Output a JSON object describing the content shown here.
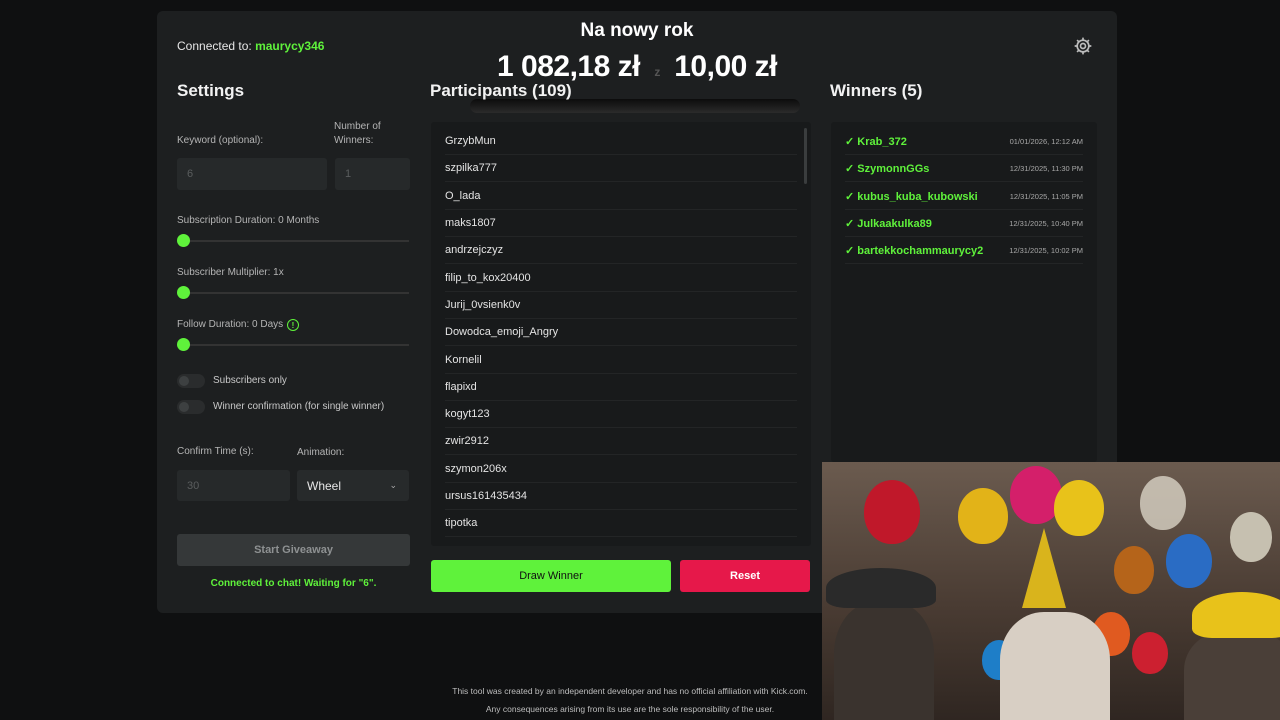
{
  "header": {
    "connected_label": "Connected to: ",
    "connected_user": "maurycy346"
  },
  "overlay": {
    "title": "Na nowy rok",
    "amount_left": "1 082,18 zł",
    "amount_mid": "z",
    "amount_right": "10,00 zł"
  },
  "settings": {
    "title": "Settings",
    "keyword_label": "Keyword (optional):",
    "keyword_value": "6",
    "winners_label": "Number of Winners:",
    "winners_value": "1",
    "sub_duration_label": "Subscription Duration: 0 Months",
    "sub_multiplier_label": "Subscriber Multiplier: 1x",
    "follow_duration_label": "Follow Duration: 0 Days",
    "subscribers_only_label": "Subscribers only",
    "winner_confirmation_label": "Winner confirmation (for single winner)",
    "confirm_time_label": "Confirm Time (s):",
    "confirm_time_value": "30",
    "animation_label": "Animation:",
    "animation_value": "Wheel",
    "start_button": "Start Giveaway",
    "status_text": "Connected to chat! Waiting for \"6\"."
  },
  "participants": {
    "title": "Participants (109)",
    "items": [
      "GrzybMun",
      "szpilka777",
      "O_lada",
      "maks1807",
      "andrzejczyz",
      "filip_to_kox20400",
      "Jurij_0vsienk0v",
      "Dowodca_emoji_Angry",
      "Kornelil",
      "flapixd",
      "kogyt123",
      "zwir2912",
      "szymon206x",
      "ursus161435434",
      "tipotka"
    ]
  },
  "actions": {
    "draw_button": "Draw Winner",
    "reset_button": "Reset"
  },
  "winners": {
    "title": "Winners (5)",
    "items": [
      {
        "name": "✓ Krab_372",
        "date": "01/01/2026, 12:12 AM"
      },
      {
        "name": "✓ SzymonnGGs",
        "date": "12/31/2025, 11:30 PM"
      },
      {
        "name": "✓ kubus_kuba_kubowski",
        "date": "12/31/2025, 11:05 PM"
      },
      {
        "name": "✓ Julkaakulka89",
        "date": "12/31/2025, 10:40 PM"
      },
      {
        "name": "✓ bartekkochammaurycy2",
        "date": "12/31/2025, 10:02 PM"
      }
    ]
  },
  "footer": {
    "line1": "This tool was created by an independent developer and has no official affiliation with Kick.com.",
    "line2": "Any consequences arising from its use are the sole responsibility of the user."
  },
  "colors": {
    "accent": "#5ff23b",
    "reset": "#e6184a",
    "panel": "#1d1f20"
  }
}
